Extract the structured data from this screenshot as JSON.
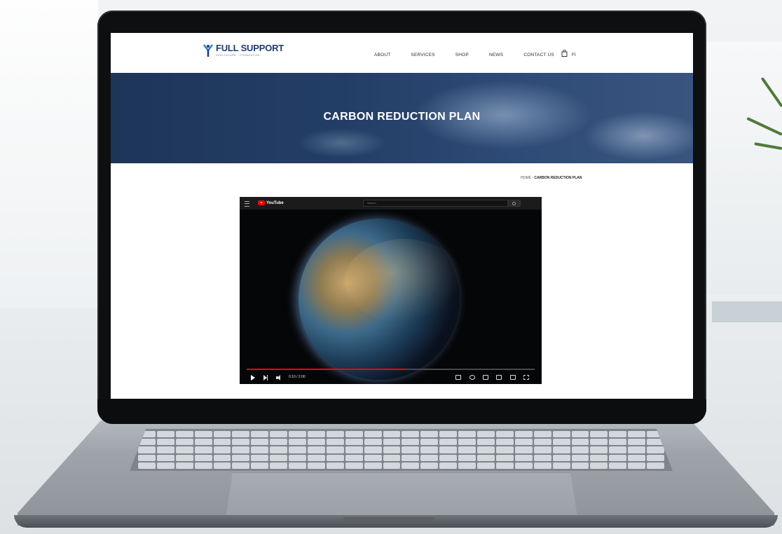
{
  "site": {
    "logo_name": "FULL SUPPORT",
    "logo_tagline": "HEALTHCARE · FOUNDATION",
    "nav": [
      "ABOUT",
      "SERVICES",
      "SHOP",
      "NEWS",
      "CONTACT US"
    ],
    "lang": "FI",
    "hero_title": "CARBON REDUCTION PLAN",
    "breadcrumb_home": "HOME",
    "breadcrumb_sep": " › ",
    "breadcrumb_current": "CARBON REDUCTION PLAN",
    "brand_color": "#1f3d6e"
  },
  "video": {
    "brand": "YouTube",
    "search_placeholder": "Search",
    "time": "0:10 / 2:00",
    "progress": 0.55,
    "accent": "#ff0000"
  }
}
